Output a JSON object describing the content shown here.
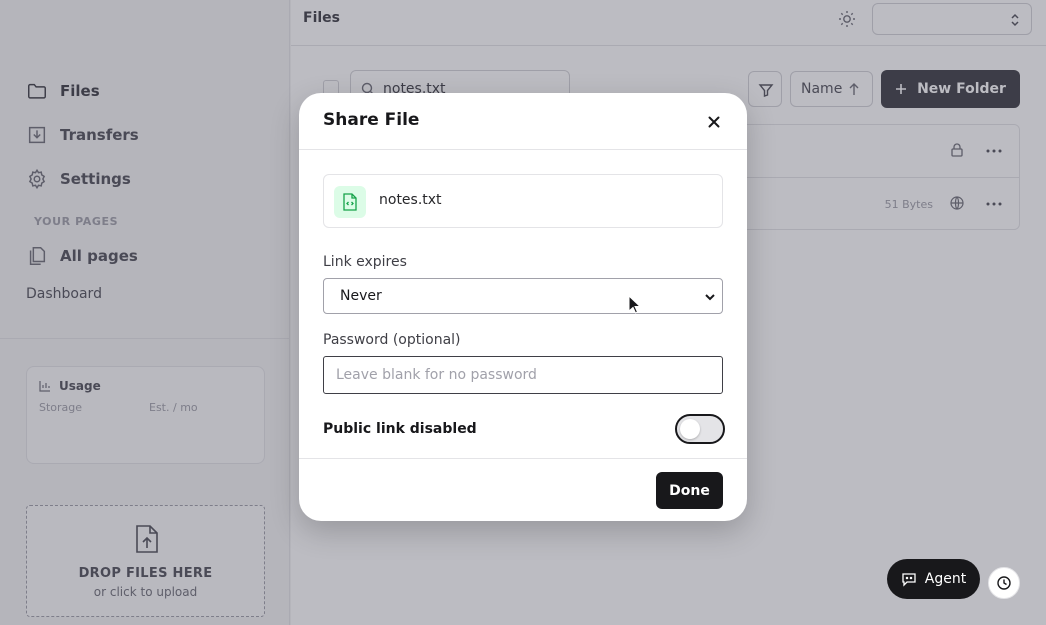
{
  "sidebar": {
    "nav": [
      {
        "label": "Files",
        "icon": "folder-icon"
      },
      {
        "label": "Transfers",
        "icon": "download-tray-icon"
      },
      {
        "label": "Settings",
        "icon": "gear-icon"
      }
    ],
    "pages_heading": "YOUR PAGES",
    "all_pages_label": "All pages",
    "dashboard_label": "Dashboard",
    "usage": {
      "title": "Usage",
      "storage_label": "Storage",
      "estimate_label": "Est. / mo"
    },
    "dropzone": {
      "title": "DROP FILES HERE",
      "subtitle": "or click to upload"
    }
  },
  "header": {
    "title": "Files",
    "workspace_value": ""
  },
  "toolbar": {
    "search_value": "notes.txt",
    "sort_label": "Name",
    "new_folder_label": "New Folder"
  },
  "file_rows": [
    {
      "size": "",
      "visibility_icon": "lock-icon"
    },
    {
      "size": "51 Bytes",
      "visibility_icon": "globe-icon"
    }
  ],
  "modal": {
    "title": "Share File",
    "file_name": "notes.txt",
    "expires_label": "Link expires",
    "expires_value": "Never",
    "password_label": "Password (optional)",
    "password_placeholder": "Leave blank for no password",
    "password_value": "",
    "public_link_label": "Public link disabled",
    "public_link_enabled": false,
    "done_label": "Done"
  },
  "agent": {
    "label": "Agent"
  },
  "colors": {
    "primary": "#18181b",
    "file_badge_bg": "#dcfce7",
    "file_badge_fg": "#16a34a"
  }
}
